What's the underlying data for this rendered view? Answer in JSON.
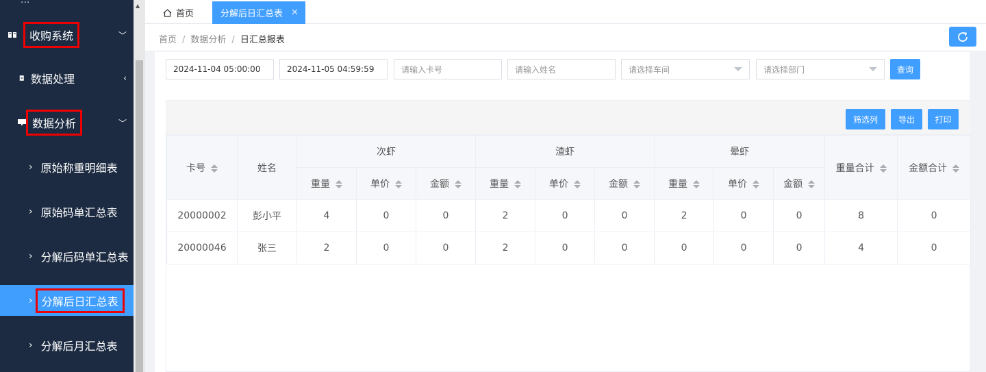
{
  "sidebar": {
    "top_partial": "...",
    "group_purchase": "收购系统",
    "group_data_processing": "数据处理",
    "group_data_analysis": "数据分析",
    "items": [
      {
        "label": "原始称重明细表"
      },
      {
        "label": "原始码单汇总表"
      },
      {
        "label": "分解后码单汇总表"
      },
      {
        "label": "分解后日汇总表"
      },
      {
        "label": "分解后月汇总表"
      }
    ]
  },
  "tabs": [
    {
      "label": "首页"
    },
    {
      "label": "分解后日汇总表"
    }
  ],
  "breadcrumb": [
    "首页",
    "数据分析",
    "日汇总报表"
  ],
  "filters": {
    "start_time": "2024-11-04 05:00:00",
    "end_time": "2024-11-05 04:59:59",
    "card_placeholder": "请输入卡号",
    "name_placeholder": "请输入姓名",
    "workshop_placeholder": "请选择车间",
    "department_placeholder": "请选择部门",
    "query_label": "查询"
  },
  "toolbar": {
    "filter_cols": "筛选列",
    "export": "导出",
    "print": "打印"
  },
  "table": {
    "col_card": "卡号",
    "col_name": "姓名",
    "groups": [
      "次虾",
      "渣虾",
      "晕虾"
    ],
    "sub_cols": [
      "重量",
      "单价",
      "金额"
    ],
    "col_total_weight": "重量合计",
    "col_total_amount": "金额合计",
    "rows": [
      {
        "card": "20000002",
        "name": "彭小平",
        "vals": [
          "4",
          "0",
          "0",
          "2",
          "0",
          "0",
          "2",
          "0",
          "0"
        ],
        "total_weight": "8",
        "total_amount": "0"
      },
      {
        "card": "20000046",
        "name": "张三",
        "vals": [
          "2",
          "0",
          "0",
          "2",
          "0",
          "0",
          "0",
          "0",
          "0"
        ],
        "total_weight": "4",
        "total_amount": "0"
      }
    ]
  }
}
